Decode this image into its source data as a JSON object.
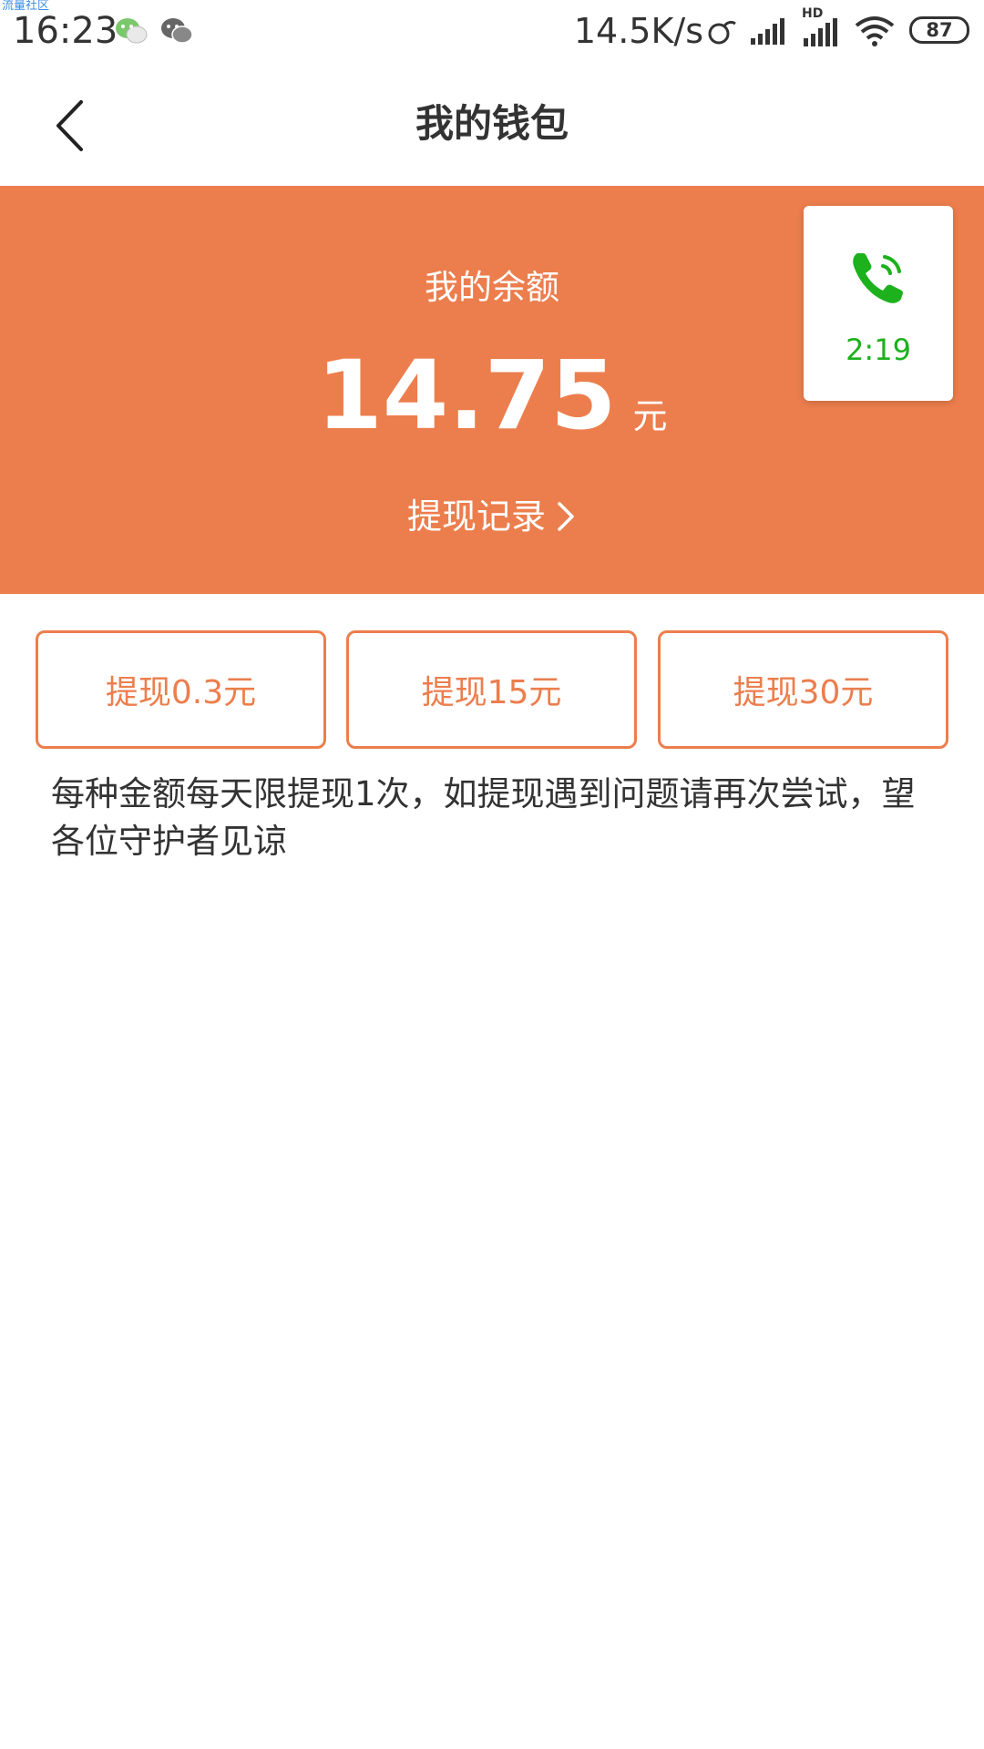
{
  "status_bar": {
    "corner_label": "流量社区",
    "time": "16:23",
    "app_icons": [
      "wechat-icon",
      "wechat-alt-icon"
    ],
    "network_speed": "14.5K/s",
    "hd_label": "HD",
    "battery_level": "87",
    "status_icons": [
      "link-icon",
      "signal-icon",
      "signal-hd-icon",
      "wifi-icon",
      "battery-icon"
    ]
  },
  "header": {
    "title": "我的钱包",
    "back_icon": "chevron-left-icon"
  },
  "balance": {
    "label": "我的余额",
    "amount": "14.75",
    "unit": "元",
    "record_link": "提现记录",
    "record_icon": "chevron-right-icon"
  },
  "call_widget": {
    "icon": "phone-icon",
    "duration": "2:19",
    "color": "#1db11d"
  },
  "withdraw_options": [
    {
      "label": "提现0.3元"
    },
    {
      "label": "提现15元"
    },
    {
      "label": "提现30元"
    }
  ],
  "notice": "每种金额每天限提现1次，如提现遇到问题请再次尝试，望各位守护者见谅",
  "colors": {
    "accent": "#ec7e4d",
    "text": "#333333",
    "call_green": "#1db11d"
  }
}
